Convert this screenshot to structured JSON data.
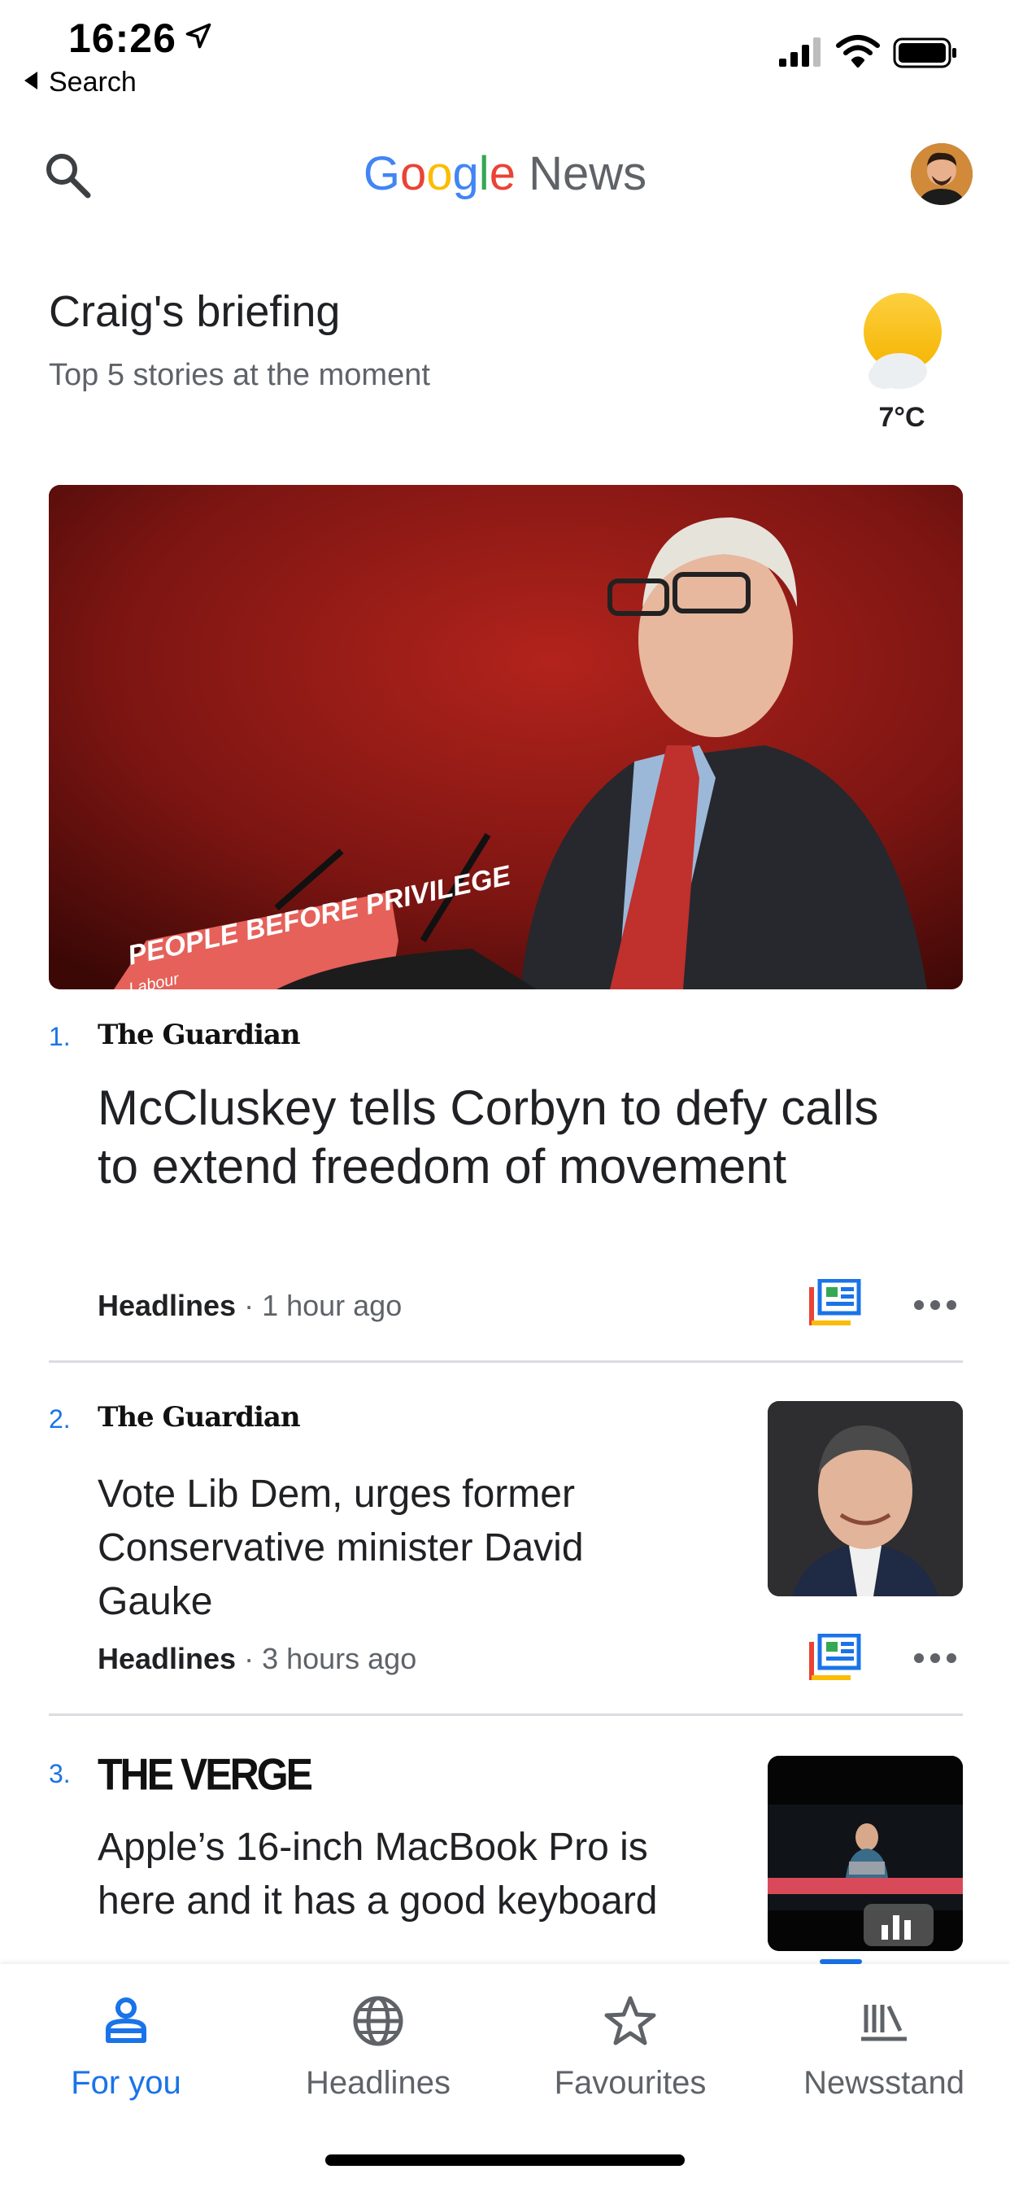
{
  "status_bar": {
    "time": "16:26",
    "back_label": "Search"
  },
  "app_bar": {
    "logo": {
      "g": "G",
      "o1": "o",
      "o2": "o",
      "g2": "g",
      "l": "l",
      "e": "e",
      "news": "News"
    }
  },
  "briefing": {
    "title": "Craig's briefing",
    "subtitle": "Top 5 stories at the moment",
    "temperature": "7°C",
    "weather_icon": "partly-cloudy-icon"
  },
  "hero": {
    "podium_text": "PEOPLE BEFORE PRIVILEGE",
    "podium_sub": "Labour"
  },
  "stories": [
    {
      "rank": "1.",
      "publisher": "The Guardian",
      "headline": "McCluskey tells Corbyn to defy calls to extend freedom of movement",
      "source": "Headlines",
      "time": "1 hour ago"
    },
    {
      "rank": "2.",
      "publisher": "The Guardian",
      "headline": "Vote Lib Dem, urges former Conservative minister David Gauke",
      "source": "Headlines",
      "time": "3 hours ago"
    },
    {
      "rank": "3.",
      "publisher": "THE VERGE",
      "headline": "Apple’s 16-inch MacBook Pro is here and it has a good keyboard",
      "source": "",
      "time": ""
    }
  ],
  "meta_separator": " · ",
  "bottom_nav": [
    {
      "label": "For you",
      "icon": "for-you-icon",
      "active": true
    },
    {
      "label": "Headlines",
      "icon": "globe-icon",
      "active": false
    },
    {
      "label": "Favourites",
      "icon": "star-icon",
      "active": false
    },
    {
      "label": "Newsstand",
      "icon": "newsstand-icon",
      "active": false
    }
  ],
  "colors": {
    "accent": "#1a73e8",
    "text_primary": "#202124",
    "text_secondary": "#5f6368",
    "divider": "#dadce0"
  }
}
